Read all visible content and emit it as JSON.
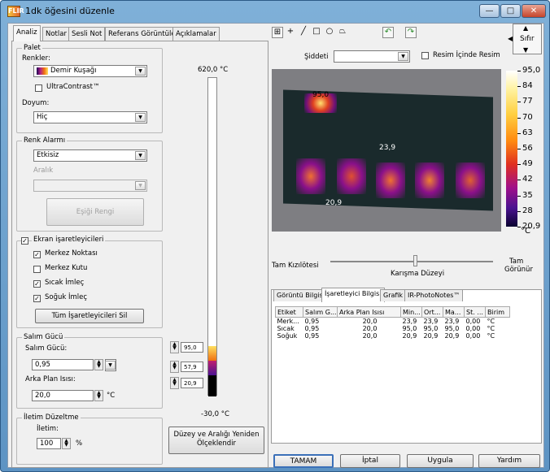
{
  "window": {
    "title": "1dk öğesini düzenle",
    "app_icon_text": "FLIR",
    "minimize": "—",
    "maximize": "□",
    "close": "✕"
  },
  "tabs": [
    "Analiz",
    "Notlar",
    "Sesli Not",
    "Referans Görüntüler",
    "Açıklamalar"
  ],
  "palette": {
    "group": "Palet",
    "colors_label": "Renkler:",
    "colors_value": "Demir Kuşağı",
    "ultracontrast_label": "UltraContrast™",
    "ultracontrast_checked": false,
    "saturation_label": "Doyum:",
    "saturation_value": "Hiç"
  },
  "color_alarm": {
    "group": "Renk Alarmı",
    "value": "Etkisiz",
    "range_label": "Aralık",
    "range_value": "",
    "threshold_button": "Eşiği Rengi"
  },
  "markers": {
    "group_label": "Ekran işaretleyicileri",
    "group_checked": true,
    "items": [
      {
        "label": "Merkez Noktası",
        "checked": true
      },
      {
        "label": "Merkez Kutu",
        "checked": false
      },
      {
        "label": "Sıcak İmleç",
        "checked": true
      },
      {
        "label": "Soğuk İmleç",
        "checked": true
      }
    ],
    "delete_all": "Tüm İşaretleyicileri Sil"
  },
  "emissivity": {
    "group": "Salım Gücü",
    "label": "Salım Gücü:",
    "value": "0,95",
    "bg_label": "Arka Plan Isısı:",
    "bg_value": "20,0",
    "bg_unit": "°C"
  },
  "transmission": {
    "group": "İletim Düzeltme",
    "label": "İletim:",
    "value": "100",
    "unit": "%"
  },
  "levelbar": {
    "top_label": "620,0 °C",
    "bottom_label": "-30,0 °C",
    "marker_values": [
      "95,0",
      "57,9",
      "20,9"
    ],
    "rescale_button": "Düzey ve Aralığı Yeniden Ölçeklendir"
  },
  "toolbar": {
    "icons": [
      "select-icon",
      "crosshair-icon",
      "line-icon",
      "rectangle-icon",
      "ellipse-icon",
      "polygon-icon",
      "rotate-left-icon",
      "rotate-right-icon"
    ],
    "zoom_button": "Sıfır",
    "intensity_label": "Şiddeti",
    "intensity_value": "",
    "pip_label": "Resim İçinde Resim",
    "pip_checked": false
  },
  "image_markers": [
    {
      "label": "95,0"
    },
    {
      "label": "23,9"
    },
    {
      "label": "20,9"
    }
  ],
  "temp_scale": {
    "ticks": [
      "95,0",
      "84",
      "77",
      "70",
      "63",
      "56",
      "49",
      "42",
      "35",
      "28",
      "20,9"
    ],
    "unit": "°C"
  },
  "blend": {
    "left": "Tam Kızılötesi",
    "right_top": "Tam",
    "right_bottom": "Görünür",
    "center": "Karışma Düzeyi"
  },
  "bottom_tabs": [
    "Görüntü Bilgisi",
    "İşaretleyici Bilgisi",
    "Grafik",
    "IR-PhotoNotes™"
  ],
  "table": {
    "headers": [
      "Etiket",
      "Salım G...",
      "Arka Plan Isısı",
      "Min...",
      "Ort...",
      "Ma...",
      "St. ...",
      "Birim"
    ],
    "rows": [
      [
        "Merk...",
        "0,95",
        "20,0",
        "23,9",
        "23,9",
        "23,9",
        "0,00",
        "°C"
      ],
      [
        "Sıcak",
        "0,95",
        "20,0",
        "95,0",
        "95,0",
        "95,0",
        "0,00",
        "°C"
      ],
      [
        "Soğuk",
        "0,95",
        "20,0",
        "20,9",
        "20,9",
        "20,9",
        "0,00",
        "°C"
      ]
    ]
  },
  "footer": {
    "ok": "TAMAM",
    "cancel": "İptal",
    "apply": "Uygula",
    "help": "Yardım"
  }
}
